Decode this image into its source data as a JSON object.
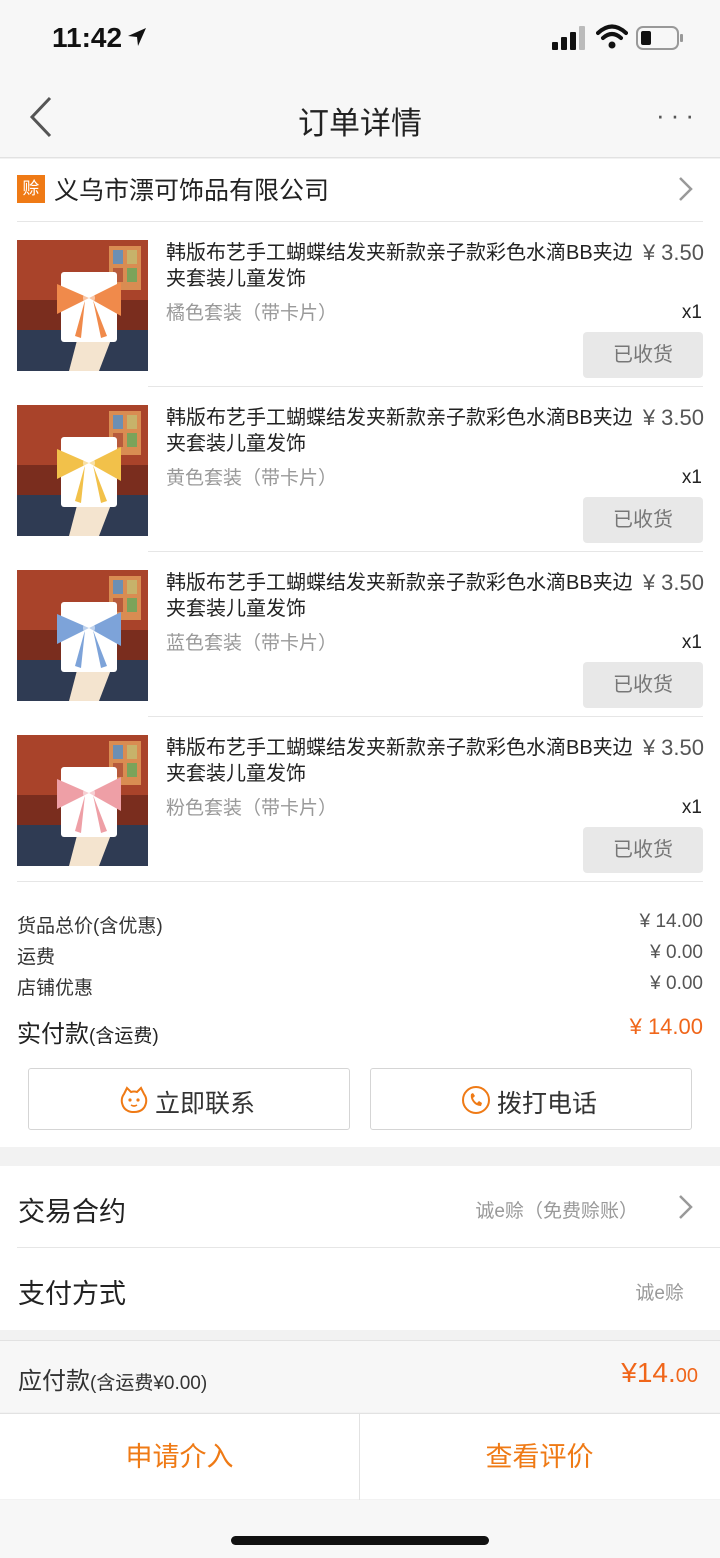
{
  "status_bar": {
    "time": "11:42"
  },
  "nav": {
    "title": "订单详情",
    "more": "···"
  },
  "shop": {
    "badge": "赊",
    "name": "义乌市漂可饰品有限公司"
  },
  "items": [
    {
      "title": "韩版布艺手工蝴蝶结发夹新款亲子款彩色水滴BB夹边夹套装儿童发饰",
      "price": "¥ 3.50",
      "spec": "橘色套装（带卡片）",
      "qty": "x1",
      "status": "已收货",
      "bow_color": "#f08a4b"
    },
    {
      "title": "韩版布艺手工蝴蝶结发夹新款亲子款彩色水滴BB夹边夹套装儿童发饰",
      "price": "¥ 3.50",
      "spec": "黄色套装（带卡片）",
      "qty": "x1",
      "status": "已收货",
      "bow_color": "#f2c14a"
    },
    {
      "title": "韩版布艺手工蝴蝶结发夹新款亲子款彩色水滴BB夹边夹套装儿童发饰",
      "price": "¥ 3.50",
      "spec": "蓝色套装（带卡片）",
      "qty": "x1",
      "status": "已收货",
      "bow_color": "#7da3d9"
    },
    {
      "title": "韩版布艺手工蝴蝶结发夹新款亲子款彩色水滴BB夹边夹套装儿童发饰",
      "price": "¥ 3.50",
      "spec": "粉色套装（带卡片）",
      "qty": "x1",
      "status": "已收货",
      "bow_color": "#ee9fa6"
    }
  ],
  "summary": {
    "goods_total_label": "货品总价(含优惠)",
    "goods_total": "¥ 14.00",
    "shipping_label": "运费",
    "shipping": "¥ 0.00",
    "shop_discount_label": "店铺优惠",
    "shop_discount": "¥ 0.00",
    "paid_label": "实付款",
    "paid_sub": "(含运费)",
    "paid": "¥ 14.00"
  },
  "actions": {
    "contact": "立即联系",
    "call": "拨打电话"
  },
  "contract": {
    "label": "交易合约",
    "value": "诚e赊（免费赊账）"
  },
  "payment": {
    "label": "支付方式",
    "value": "诚e赊"
  },
  "payable": {
    "label": "应付款",
    "sub": "(含运费¥0.00)",
    "value_main": "¥14.",
    "value_cents": "00"
  },
  "bottom": {
    "intervene": "申请介入",
    "review": "查看评价"
  },
  "colors": {
    "accent": "#ef7a15",
    "price": "#f0661a"
  }
}
